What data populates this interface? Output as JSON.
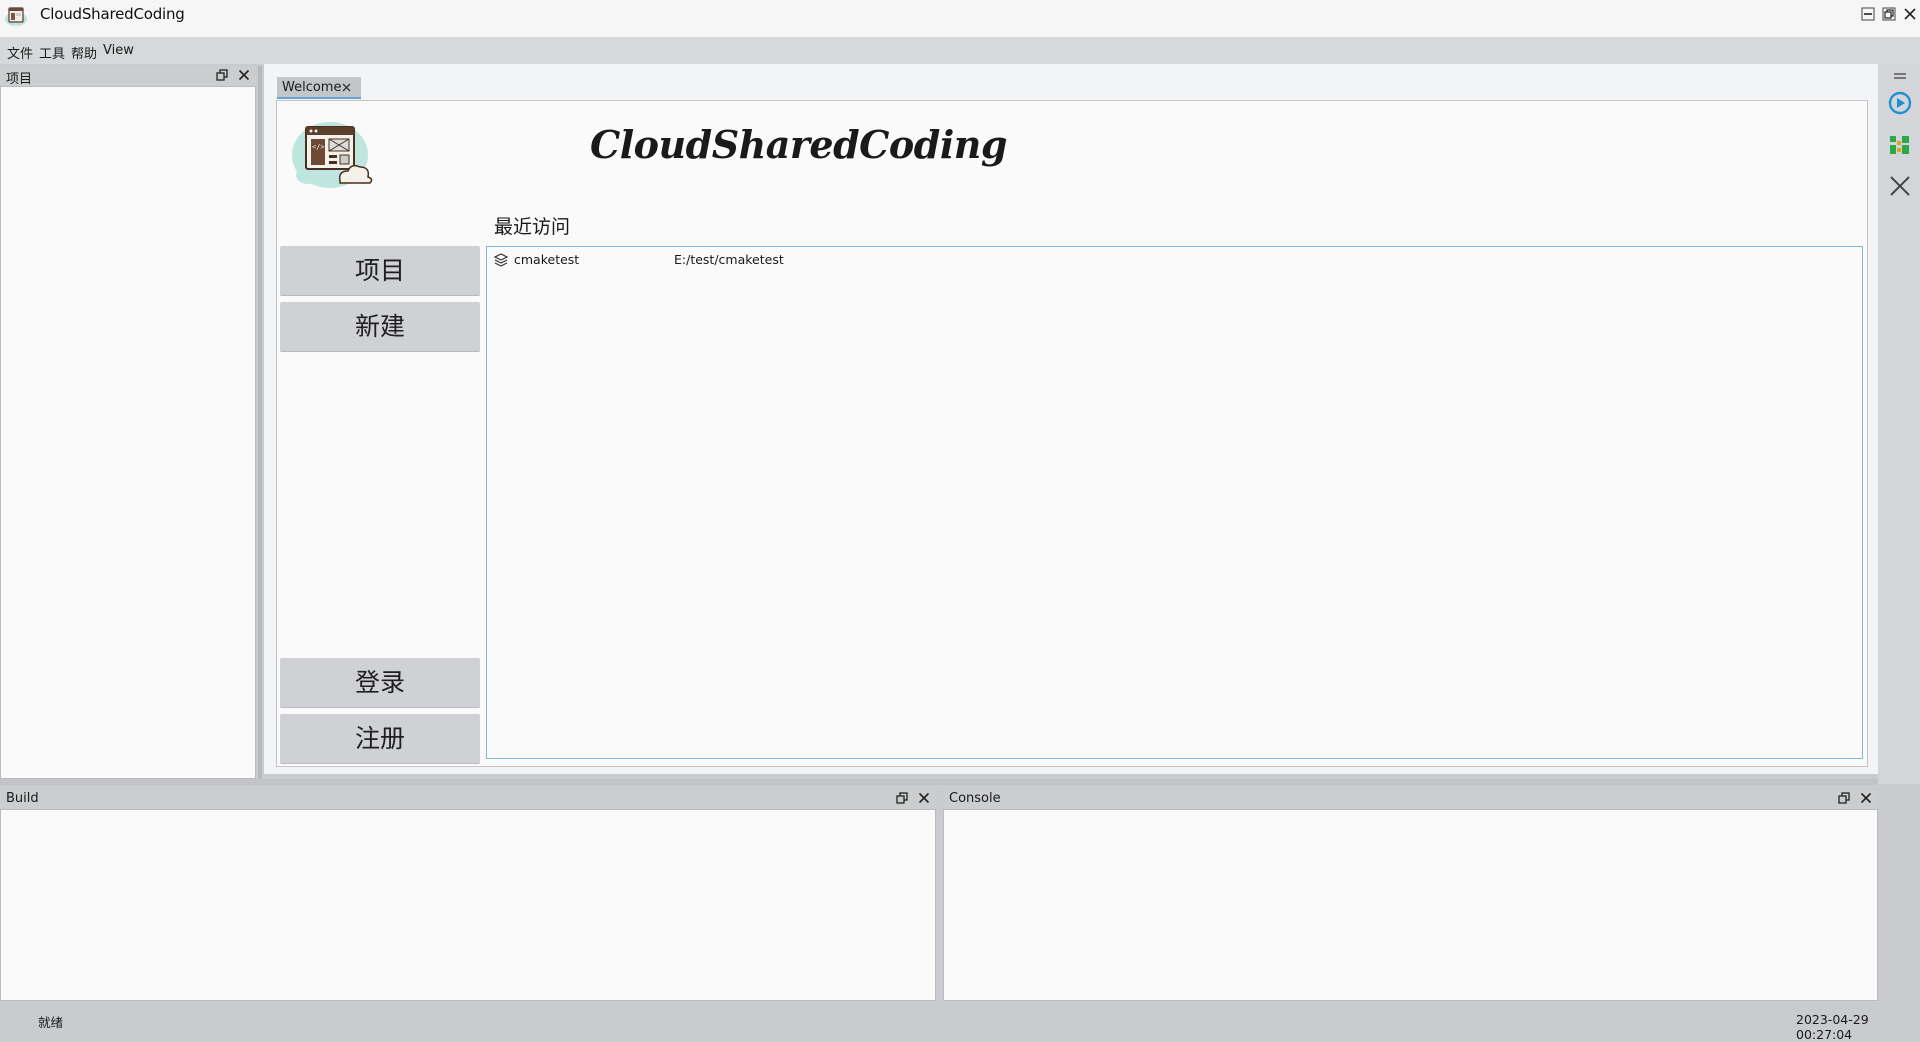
{
  "app": {
    "title": "CloudSharedCoding"
  },
  "window_controls": {
    "minimize": "minimize-icon",
    "maximize": "restore-icon",
    "close": "close-icon"
  },
  "menu": [
    "文件",
    "工具",
    "帮助",
    "View"
  ],
  "project_panel": {
    "title": "项目"
  },
  "welcome_tab": {
    "label": "Welcome"
  },
  "welcome": {
    "brand": "CloudSharedCoding",
    "recent_title": "最近访问",
    "buttons": {
      "project": "项目",
      "new": "新建",
      "login": "登录",
      "register": "注册"
    },
    "recent": [
      {
        "name": "cmaketest",
        "path": "E:/test/cmaketest",
        "icon": "layers-icon"
      }
    ]
  },
  "right_toolbar": {
    "icons": [
      "menu-lines-icon",
      "play-icon",
      "blocks-icon",
      "close-icon"
    ],
    "accent": "#1e90d6"
  },
  "build_panel": {
    "title": "Build"
  },
  "console_panel": {
    "title": "Console"
  },
  "status": {
    "text": "就绪",
    "time": "2023-04-29 00:27:04"
  },
  "colors": {
    "accent_blue": "#6aa2d6",
    "list_border": "#7fb6d9"
  }
}
